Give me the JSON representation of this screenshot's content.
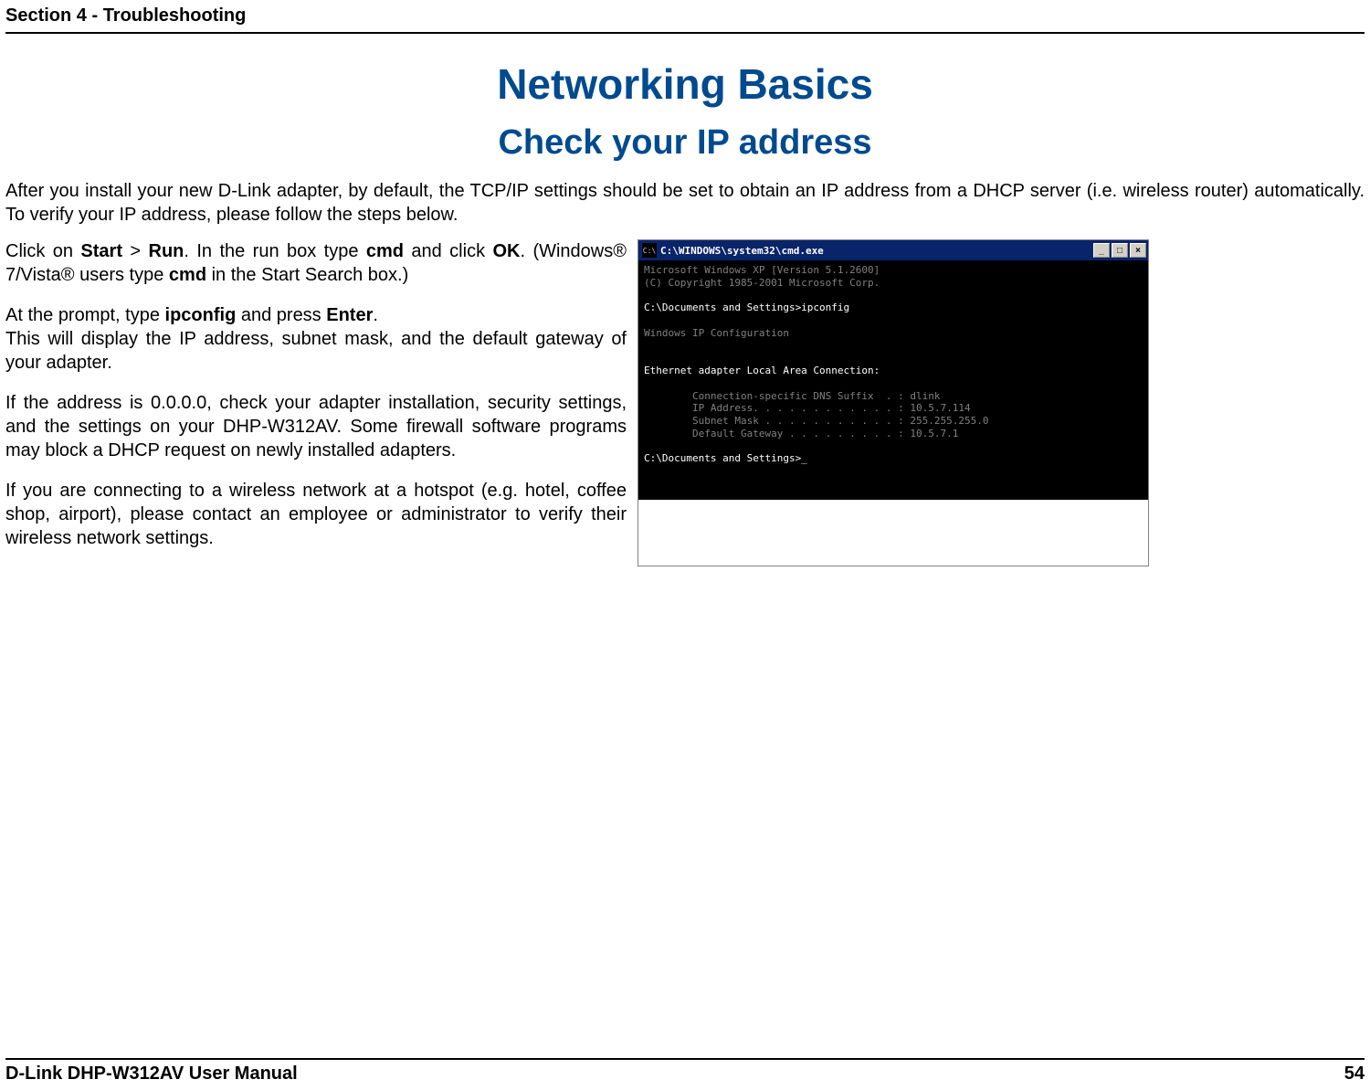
{
  "header": {
    "section": "Section 4 - Troubleshooting"
  },
  "title": {
    "main": "Networking Basics",
    "sub": "Check your IP address"
  },
  "intro": "After you install your new D-Link adapter, by default, the TCP/IP settings should be set to obtain an IP address from a DHCP server (i.e. wireless router) automatically. To verify your IP address, please follow the steps below.",
  "p1_a": "Click on ",
  "p1_b": "Start",
  "p1_c": " > ",
  "p1_d": "Run",
  "p1_e": ". In the run box type ",
  "p1_f": "cmd",
  "p1_g": " and click ",
  "p1_h": "OK",
  "p1_i": ". (Windows® 7/Vista® users type ",
  "p1_j": "cmd",
  "p1_k": " in the Start Search box.)",
  "p2_a": "At the prompt, type ",
  "p2_b": "ipconfig",
  "p2_c": " and press ",
  "p2_d": "Enter",
  "p2_e": ".",
  "p2_f": "This will display the IP address, subnet mask, and the default gateway of your adapter.",
  "p3": "If the address is 0.0.0.0, check your adapter installation, security settings, and the settings on your DHP-W312AV. Some firewall software programs may block a DHCP request on newly installed adapters.",
  "p4": "If you are connecting to a wireless network at a hotspot (e.g. hotel, coffee shop, airport), please contact an employee or administrator to verify their wireless network settings.",
  "cmd": {
    "title_prefix": "C:\\",
    "title": "C:\\WINDOWS\\system32\\cmd.exe",
    "min": "_",
    "max": "□",
    "close": "×",
    "line1": "Microsoft Windows XP [Version 5.1.2600]",
    "line2": "(C) Copyright 1985-2001 Microsoft Corp.",
    "prompt1": "C:\\Documents and Settings>ipconfig",
    "heading": "Windows IP Configuration",
    "adapter": "Ethernet adapter Local Area Connection:",
    "dns": "        Connection-specific DNS Suffix  . : dlink",
    "ip": "        IP Address. . . . . . . . . . . . : 10.5.7.114",
    "mask": "        Subnet Mask . . . . . . . . . . . : 255.255.255.0",
    "gw": "        Default Gateway . . . . . . . . . : 10.5.7.1",
    "prompt2": "C:\\Documents and Settings>_"
  },
  "footer": {
    "left": "D-Link DHP-W312AV User Manual",
    "right": "54"
  }
}
